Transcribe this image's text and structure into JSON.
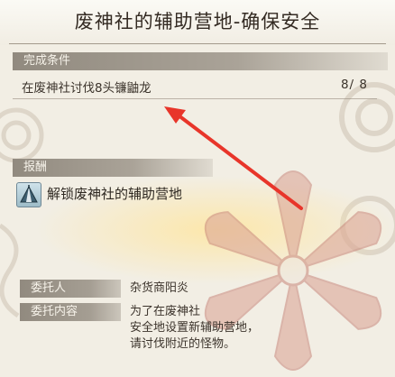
{
  "title": "废神社的辅助营地-确保安全",
  "conditions": {
    "header": "完成条件",
    "items": [
      {
        "text": "在废神社讨伐8头镰鼬龙",
        "progress": "8/ 8"
      }
    ]
  },
  "reward": {
    "header": "报酬",
    "icon": "tent-icon",
    "text": "解锁废神社的辅助营地"
  },
  "details": {
    "client_label": "委托人",
    "client_value": "杂货商阳炎",
    "content_label": "委托内容",
    "content_lines": [
      "为了在废神社",
      "安全地设置新辅助营地，",
      "请讨伐附近的怪物。"
    ]
  },
  "colors": {
    "arrow": "#e8352a",
    "header_bg": "#918a7f",
    "flower": "#d9a092"
  }
}
